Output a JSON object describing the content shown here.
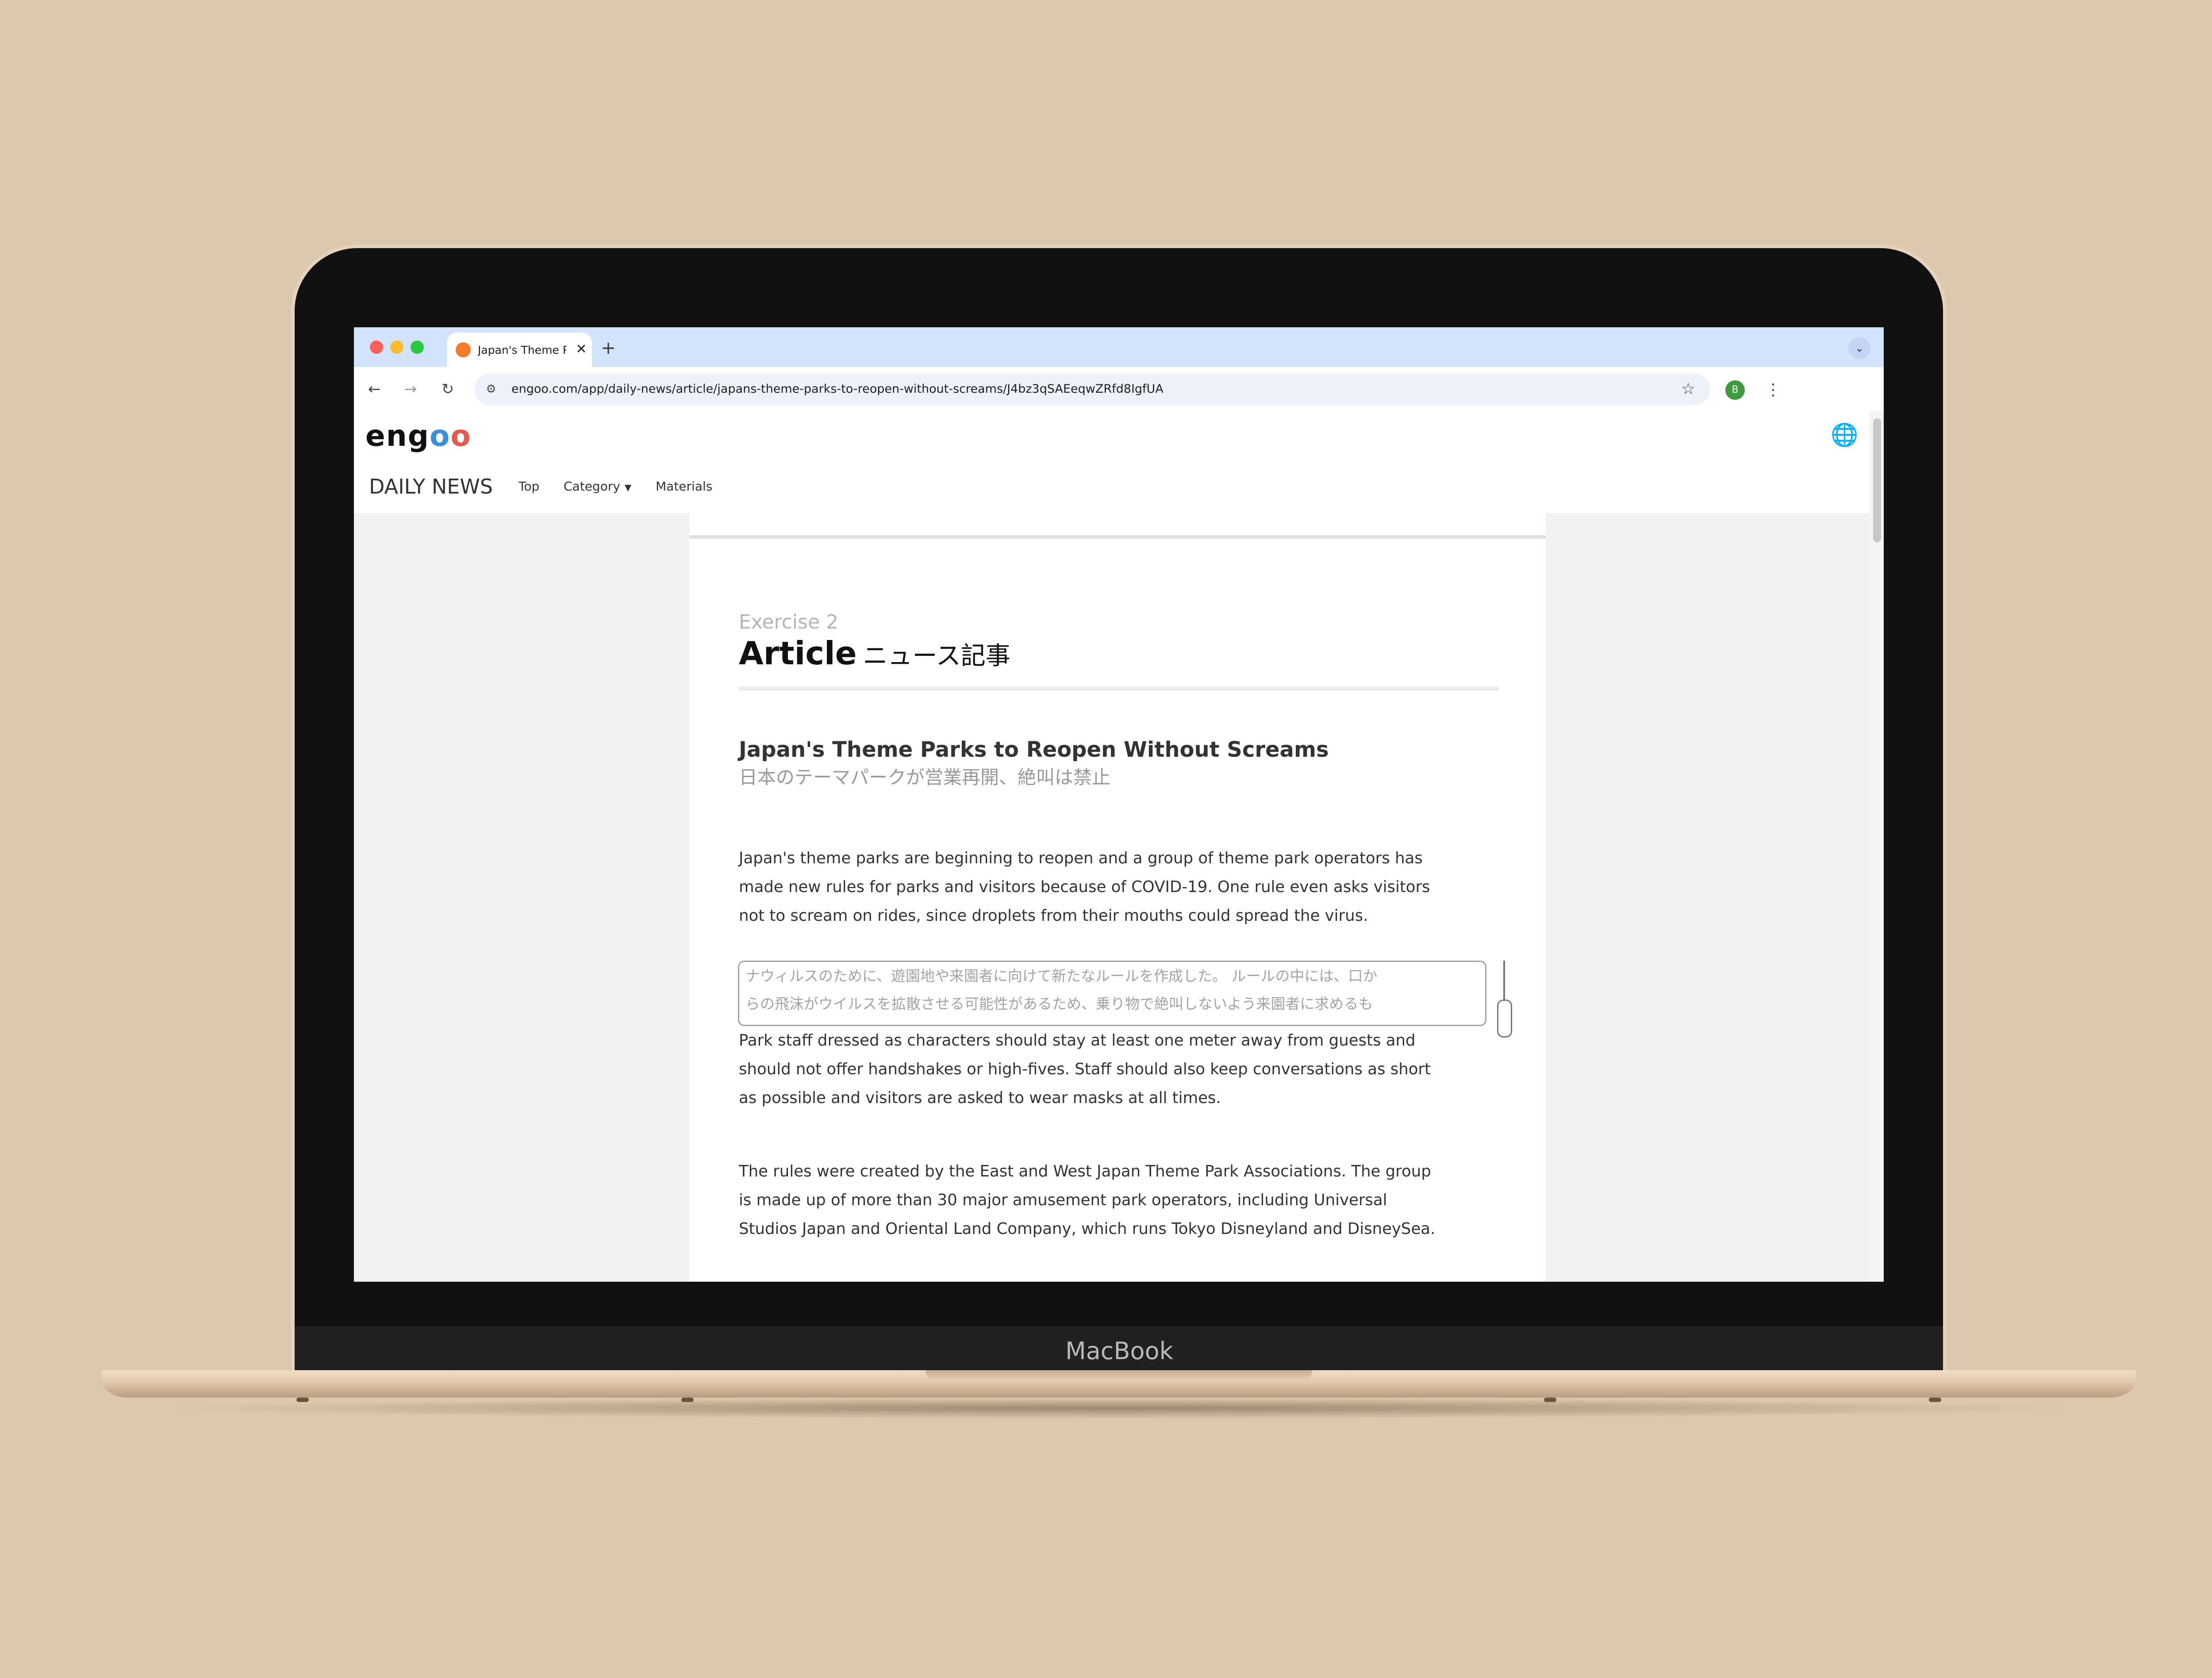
{
  "device": {
    "brand": "MacBook"
  },
  "browser": {
    "tab": {
      "title": "Japan's Theme Parks to Reop",
      "close": "✕"
    },
    "new_tab": "+",
    "tab_menu": "⌄",
    "nav": {
      "back": "←",
      "forward": "→",
      "reload": "↻"
    },
    "url": "engoo.com/app/daily-news/article/japans-theme-parks-to-reopen-without-screams/J4bz3qSAEeqwZRfd8IgfUA",
    "profile_initial": "B",
    "star": "☆",
    "menu": "⋮",
    "site_settings_icon": "⚙"
  },
  "site": {
    "logo": {
      "part1": "eng",
      "o1": "o",
      "o2": "o"
    },
    "globe": "🌐",
    "nav": {
      "brand": "DAILY NEWS",
      "top": "Top",
      "category": "Category",
      "caret": "▼",
      "materials": "Materials"
    }
  },
  "article": {
    "exercise": "Exercise 2",
    "heading_en": "Article",
    "heading_ja": "ニュース記事",
    "title": "Japan's Theme Parks to Reopen Without Screams",
    "title_ja": "日本のテーマパークが営業再開、絶叫は禁止",
    "paragraph1": [
      "Japan's theme parks are beginning to reopen and a group of theme park operators has",
      "made new rules for parks and visitors because of COVID-19. One rule even asks visitors",
      "not to scream on rides, since droplets from their mouths could spread the virus."
    ],
    "translation": [
      "ナウィルスのために、遊園地や来園者に向けて新たなルールを作成した。 ルールの中には、口か",
      "らの飛沫がウイルスを拡散させる可能性があるため、乗り物で絶叫しないよう来園者に求めるも"
    ],
    "paragraph2": [
      "Park staff dressed as characters should stay at least one meter away from guests and",
      "should not offer handshakes or high-fives. Staff should also keep conversations as short",
      "as possible and visitors are asked to wear masks at all times."
    ],
    "paragraph3": [
      "The rules were created by the East and West Japan Theme Park Associations. The group",
      "is made up of more than 30 major amusement park operators, including Universal",
      "Studios Japan and Oriental Land Company, which runs Tokyo Disneyland and DisneySea."
    ]
  },
  "colors": {
    "background": "#dcc8ae",
    "tabstrip": "#d4e3fc",
    "traffic_close": "#ff5f57",
    "traffic_min": "#febc2e",
    "traffic_max": "#28c840",
    "side_gray": "#f2f2f2"
  }
}
